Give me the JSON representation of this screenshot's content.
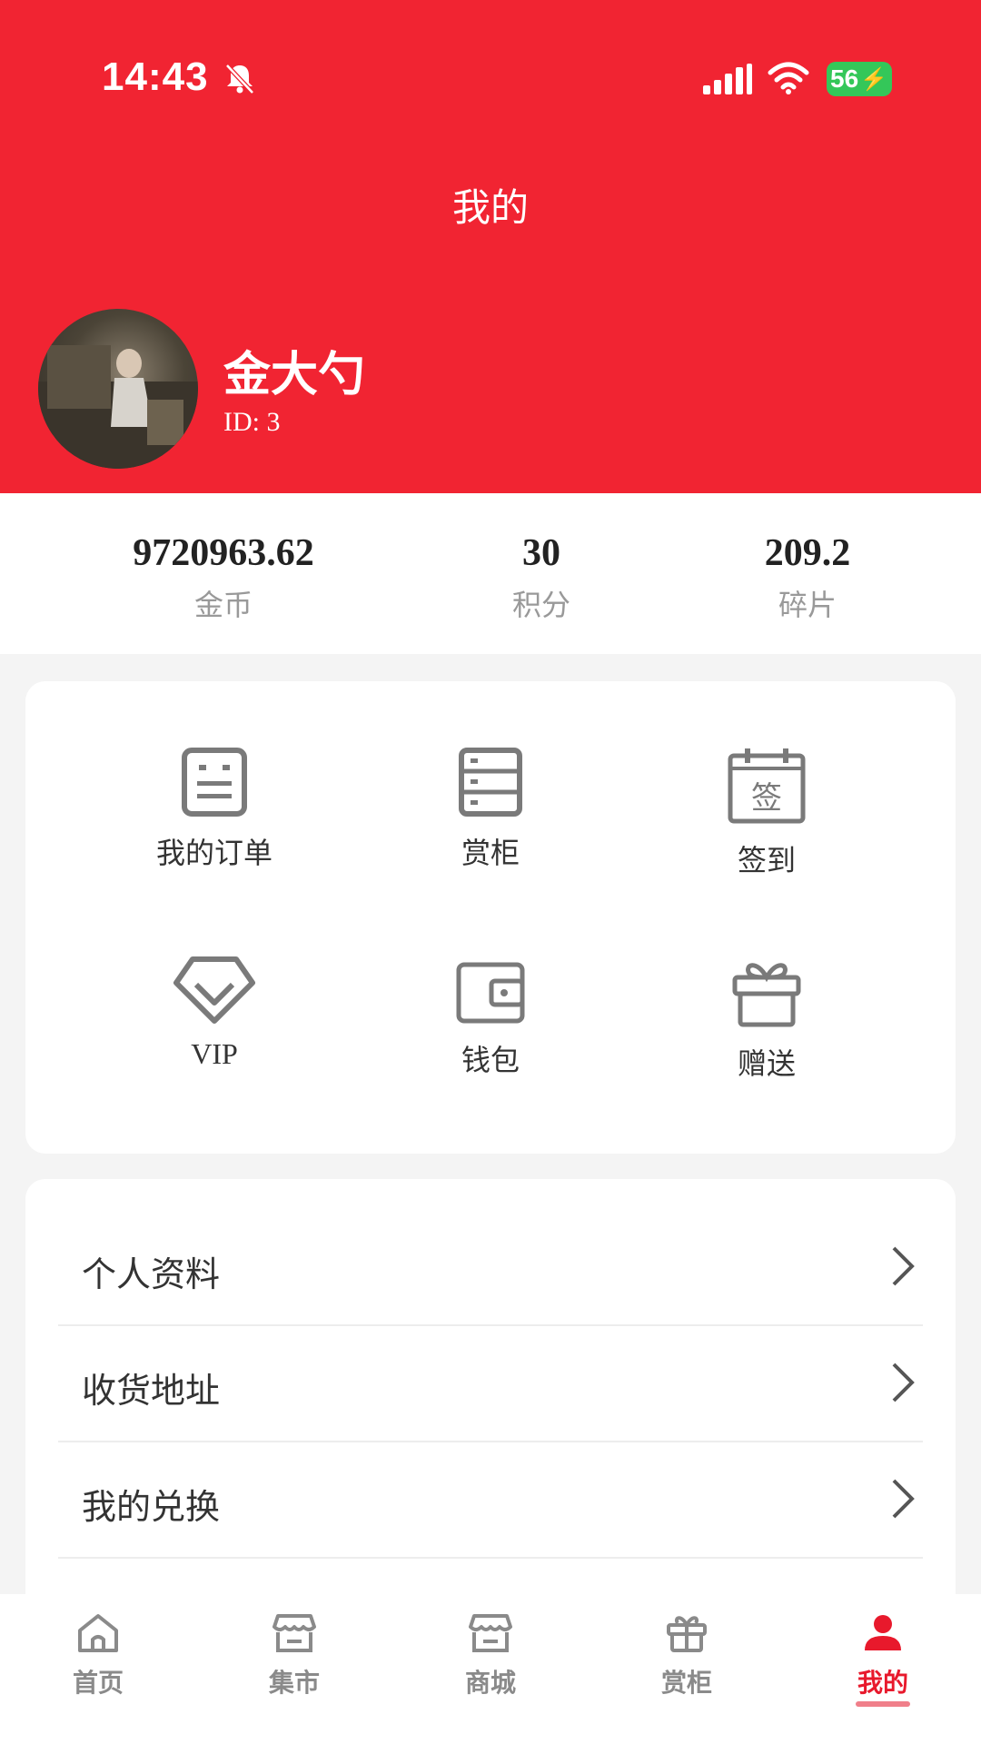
{
  "status_bar": {
    "time": "14:43",
    "battery": "56"
  },
  "header": {
    "title": "我的"
  },
  "user": {
    "name": "金大勺",
    "id_text": "ID: 3"
  },
  "stats": [
    {
      "value": "9720963.62",
      "label": "金币"
    },
    {
      "value": "30",
      "label": "积分"
    },
    {
      "value": "209.2",
      "label": "碎片"
    }
  ],
  "features": [
    {
      "label": "我的订单",
      "icon": "order-icon"
    },
    {
      "label": "赏柜",
      "icon": "cabinet-icon"
    },
    {
      "label": "签到",
      "icon": "checkin-calendar-icon",
      "icon_text": "签"
    },
    {
      "label": "VIP",
      "icon": "vip-diamond-icon"
    },
    {
      "label": "钱包",
      "icon": "wallet-icon"
    },
    {
      "label": "赠送",
      "icon": "gift-icon"
    }
  ],
  "menu": [
    {
      "label": "个人资料"
    },
    {
      "label": "收货地址"
    },
    {
      "label": "我的兑换"
    }
  ],
  "tabs": [
    {
      "label": "首页",
      "icon": "home-icon"
    },
    {
      "label": "集市",
      "icon": "market-icon"
    },
    {
      "label": "商城",
      "icon": "mall-icon"
    },
    {
      "label": "赏柜",
      "icon": "gift-icon"
    },
    {
      "label": "我的",
      "icon": "user-icon",
      "active": true
    }
  ],
  "colors": {
    "brand_red": "#f12432",
    "active_tab": "#e8192c",
    "icon_gray": "#7a7a7a"
  }
}
